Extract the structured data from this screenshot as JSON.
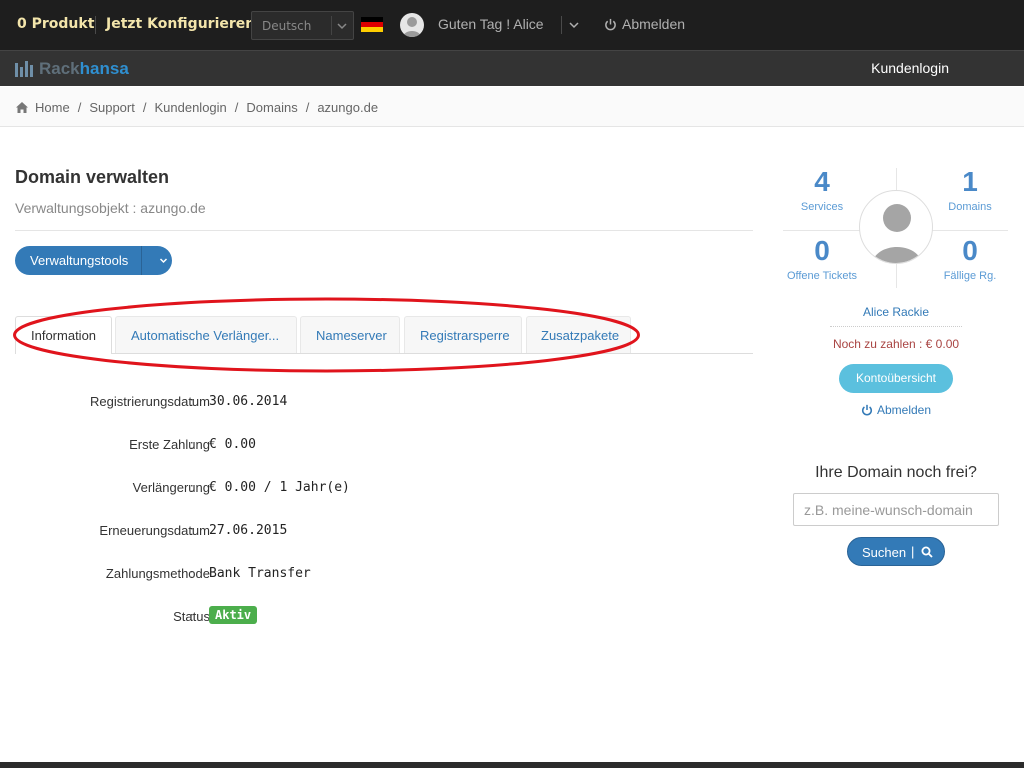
{
  "topbar": {
    "products_label": "0 Produkt",
    "configure_label": "Jetzt Konfigurieren",
    "language": "Deutsch",
    "greeting": "Guten Tag ! Alice",
    "logout_label": "Abmelden",
    "flag_colors": [
      "#000000",
      "#dd0000",
      "#ffce00"
    ]
  },
  "navbar": {
    "logo_part1": "Rack",
    "logo_part2": "hansa",
    "login_label": "Kundenlogin"
  },
  "breadcrumb": [
    "Home",
    "Support",
    "Kundenlogin",
    "Domains",
    "azungo.de"
  ],
  "main": {
    "title": "Domain verwalten",
    "subtitle": "Verwaltungsobjekt : azungo.de",
    "tools_button": "Verwaltungstools",
    "tabs": [
      {
        "label": "Information",
        "active": true
      },
      {
        "label": "Automatische Verlänger...",
        "active": false
      },
      {
        "label": "Nameserver",
        "active": false
      },
      {
        "label": "Registrarsperre",
        "active": false
      },
      {
        "label": "Zusatzpakete",
        "active": false
      }
    ],
    "info": [
      {
        "label": "Registrierungsdatum",
        "value": "30.06.2014"
      },
      {
        "label": "Erste Zahlung",
        "value": "€ 0.00"
      },
      {
        "label": "Verlängerung",
        "value": "€ 0.00 / 1 Jahr(e)"
      },
      {
        "label": "Erneuerungsdatum",
        "value": "27.06.2015"
      },
      {
        "label": "Zahlungsmethode",
        "value": "Bank Transfer"
      },
      {
        "label": "Status",
        "value": "Aktiv"
      }
    ],
    "colon": ":"
  },
  "sidebar": {
    "stats": {
      "services": {
        "value": "4",
        "label": "Services"
      },
      "domains": {
        "value": "1",
        "label": "Domains"
      },
      "tickets": {
        "value": "0",
        "label": "Offene Tickets"
      },
      "invoices": {
        "value": "0",
        "label": "Fällige Rg."
      }
    },
    "name": "Alice Rackie",
    "due": "Noch zu zahlen : € 0.00",
    "account_button": "Kontoübersicht",
    "logout_label": "Abmelden",
    "domain_question": "Ihre Domain noch frei?",
    "domain_placeholder": "z.B. meine-wunsch-domain",
    "search_button": "Suchen",
    "search_separator": "|"
  },
  "colors": {
    "primary": "#337ab7",
    "info": "#5bc0de",
    "success": "#4cae4c",
    "danger": "#a94442",
    "highlight": "#e0141c"
  }
}
